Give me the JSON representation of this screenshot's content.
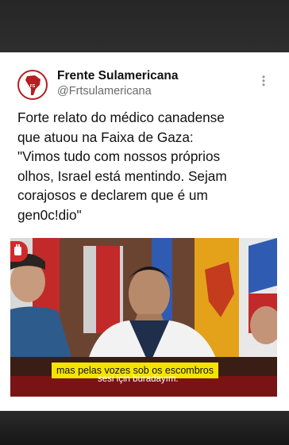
{
  "post": {
    "display_name": "Frente Sulamericana",
    "handle": "@Frtsulamericana",
    "text": "Forte relato do médico canadense\nque atuou na Faixa de Gaza:\n\"Vimos tudo com nossos próprios\nolhos, Israel está mentindo. Sejam\ncorajosos e declarem que é um\ngen0c!dio\""
  },
  "video": {
    "caption_pt": "mas pelas vozes sob os escombros",
    "caption_tr": "sesi için buradayım."
  },
  "icons": {
    "more": "more-vertical-icon",
    "avatar_logo": "south-america-map-logo",
    "badge": "fist-icon"
  },
  "colors": {
    "brand_red": "#b41f1f",
    "caption_yellow": "#f5e400"
  }
}
